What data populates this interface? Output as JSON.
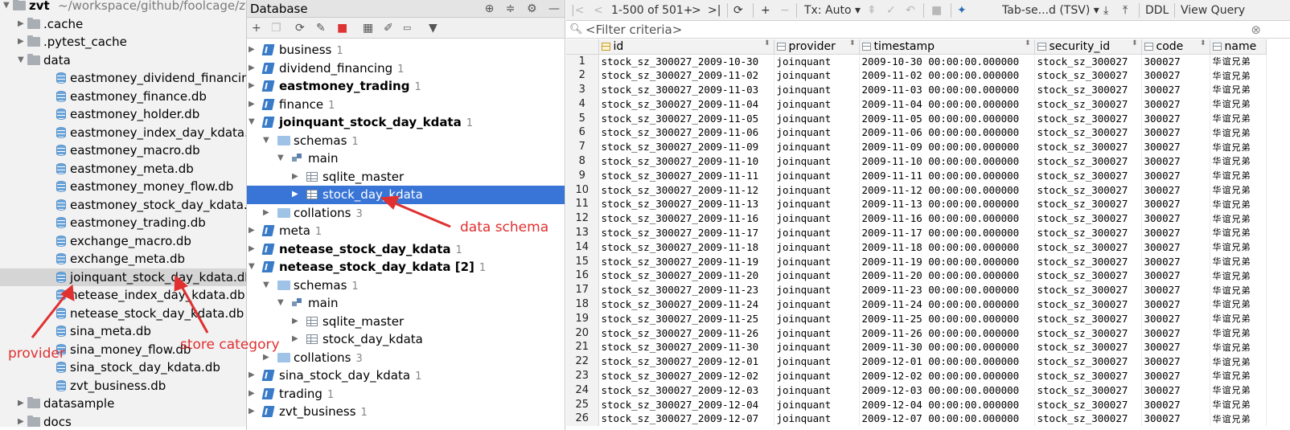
{
  "project": {
    "root_name": "zvt",
    "root_path": "~/workspace/github/foolcage/zvt",
    "rows": [
      {
        "label": "zvt",
        "type": "root",
        "indent": 0,
        "arrow": "▼"
      },
      {
        "label": ".cache",
        "type": "folder",
        "indent": 1,
        "arrow": "▶"
      },
      {
        "label": ".pytest_cache",
        "type": "folder",
        "indent": 1,
        "arrow": "▶"
      },
      {
        "label": "data",
        "type": "folder",
        "indent": 1,
        "arrow": "▼"
      },
      {
        "label": "eastmoney_dividend_financing.db",
        "type": "db",
        "indent": 2
      },
      {
        "label": "eastmoney_finance.db",
        "type": "db",
        "indent": 2
      },
      {
        "label": "eastmoney_holder.db",
        "type": "db",
        "indent": 2
      },
      {
        "label": "eastmoney_index_day_kdata.db",
        "type": "db",
        "indent": 2
      },
      {
        "label": "eastmoney_macro.db",
        "type": "db",
        "indent": 2
      },
      {
        "label": "eastmoney_meta.db",
        "type": "db",
        "indent": 2
      },
      {
        "label": "eastmoney_money_flow.db",
        "type": "db",
        "indent": 2
      },
      {
        "label": "eastmoney_stock_day_kdata.db",
        "type": "db",
        "indent": 2
      },
      {
        "label": "eastmoney_trading.db",
        "type": "db",
        "indent": 2
      },
      {
        "label": "exchange_macro.db",
        "type": "db",
        "indent": 2
      },
      {
        "label": "exchange_meta.db",
        "type": "db",
        "indent": 2
      },
      {
        "label": "joinquant_stock_day_kdata.db",
        "type": "db",
        "indent": 2,
        "selected": true
      },
      {
        "label": "netease_index_day_kdata.db",
        "type": "db",
        "indent": 2
      },
      {
        "label": "netease_stock_day_kdata.db",
        "type": "db",
        "indent": 2
      },
      {
        "label": "sina_meta.db",
        "type": "db",
        "indent": 2
      },
      {
        "label": "sina_money_flow.db",
        "type": "db",
        "indent": 2
      },
      {
        "label": "sina_stock_day_kdata.db",
        "type": "db",
        "indent": 2
      },
      {
        "label": "zvt_business.db",
        "type": "db",
        "indent": 2
      },
      {
        "label": "datasample",
        "type": "folder",
        "indent": 1,
        "arrow": "▶"
      },
      {
        "label": "docs",
        "type": "folder",
        "indent": 1,
        "arrow": "▶"
      }
    ]
  },
  "database": {
    "title": "Database",
    "header_icons": [
      "target-icon",
      "collapse-icon",
      "gear-icon",
      "minimize-icon"
    ],
    "toolbar_icons": [
      "add-icon",
      "copy-icon",
      "refresh-icon",
      "schema-sync-icon",
      "stop-icon",
      "table-icon",
      "edit-icon",
      "console-icon",
      "filter-icon"
    ],
    "tree": [
      {
        "label": "business",
        "count": "1",
        "type": "db",
        "indent": 0,
        "arrow": "▶",
        "bold": false
      },
      {
        "label": "dividend_financing",
        "count": "1",
        "type": "db",
        "indent": 0,
        "arrow": "▶",
        "bold": false
      },
      {
        "label": "eastmoney_trading",
        "count": "1",
        "type": "db",
        "indent": 0,
        "arrow": "▶",
        "bold": true
      },
      {
        "label": "finance",
        "count": "1",
        "type": "db",
        "indent": 0,
        "arrow": "▶",
        "bold": false
      },
      {
        "label": "joinquant_stock_day_kdata",
        "count": "1",
        "type": "db",
        "indent": 0,
        "arrow": "▼",
        "bold": true
      },
      {
        "label": "schemas",
        "count": "1",
        "type": "folder",
        "indent": 1,
        "arrow": "▼",
        "bold": false
      },
      {
        "label": "main",
        "count": "",
        "type": "schema",
        "indent": 2,
        "arrow": "▼",
        "bold": false
      },
      {
        "label": "sqlite_master",
        "count": "",
        "type": "table",
        "indent": 3,
        "arrow": "▶",
        "bold": false
      },
      {
        "label": "stock_day_kdata",
        "count": "",
        "type": "table",
        "indent": 3,
        "arrow": "▶",
        "bold": false,
        "selected": true
      },
      {
        "label": "collations",
        "count": "3",
        "type": "folder",
        "indent": 1,
        "arrow": "▶",
        "bold": false
      },
      {
        "label": "meta",
        "count": "1",
        "type": "db",
        "indent": 0,
        "arrow": "▶",
        "bold": false
      },
      {
        "label": "netease_stock_day_kdata",
        "count": "1",
        "type": "db",
        "indent": 0,
        "arrow": "▶",
        "bold": true
      },
      {
        "label": "netease_stock_day_kdata [2]",
        "count": "1",
        "type": "db",
        "indent": 0,
        "arrow": "▼",
        "bold": true
      },
      {
        "label": "schemas",
        "count": "1",
        "type": "folder",
        "indent": 1,
        "arrow": "▼",
        "bold": false
      },
      {
        "label": "main",
        "count": "",
        "type": "schema",
        "indent": 2,
        "arrow": "▼",
        "bold": false
      },
      {
        "label": "sqlite_master",
        "count": "",
        "type": "table",
        "indent": 3,
        "arrow": "▶",
        "bold": false
      },
      {
        "label": "stock_day_kdata",
        "count": "",
        "type": "table",
        "indent": 3,
        "arrow": "▶",
        "bold": false
      },
      {
        "label": "collations",
        "count": "3",
        "type": "folder",
        "indent": 1,
        "arrow": "▶",
        "bold": false
      },
      {
        "label": "sina_stock_day_kdata",
        "count": "1",
        "type": "db",
        "indent": 0,
        "arrow": "▶",
        "bold": false
      },
      {
        "label": "trading",
        "count": "1",
        "type": "db",
        "indent": 0,
        "arrow": "▶",
        "bold": false
      },
      {
        "label": "zvt_business",
        "count": "1",
        "type": "db",
        "indent": 0,
        "arrow": "▶",
        "bold": false
      }
    ]
  },
  "grid": {
    "toolbar": {
      "first": "|<",
      "prev": "<",
      "page_info": "1-500 of 501+",
      "next": ">",
      "last": ">|",
      "tx_mode": "Tx: Auto",
      "format": "Tab-se...d (TSV)",
      "ddl": "DDL",
      "view_query": "View Query"
    },
    "filter_placeholder": "<Filter criteria>",
    "columns": [
      "id",
      "provider",
      "timestamp",
      "security_id",
      "code",
      "name"
    ],
    "rows": [
      [
        "1",
        "stock_sz_300027_2009-10-30",
        "joinquant",
        "2009-10-30 00:00:00.000000",
        "stock_sz_300027",
        "300027",
        "华谊兄弟"
      ],
      [
        "2",
        "stock_sz_300027_2009-11-02",
        "joinquant",
        "2009-11-02 00:00:00.000000",
        "stock_sz_300027",
        "300027",
        "华谊兄弟"
      ],
      [
        "3",
        "stock_sz_300027_2009-11-03",
        "joinquant",
        "2009-11-03 00:00:00.000000",
        "stock_sz_300027",
        "300027",
        "华谊兄弟"
      ],
      [
        "4",
        "stock_sz_300027_2009-11-04",
        "joinquant",
        "2009-11-04 00:00:00.000000",
        "stock_sz_300027",
        "300027",
        "华谊兄弟"
      ],
      [
        "5",
        "stock_sz_300027_2009-11-05",
        "joinquant",
        "2009-11-05 00:00:00.000000",
        "stock_sz_300027",
        "300027",
        "华谊兄弟"
      ],
      [
        "6",
        "stock_sz_300027_2009-11-06",
        "joinquant",
        "2009-11-06 00:00:00.000000",
        "stock_sz_300027",
        "300027",
        "华谊兄弟"
      ],
      [
        "7",
        "stock_sz_300027_2009-11-09",
        "joinquant",
        "2009-11-09 00:00:00.000000",
        "stock_sz_300027",
        "300027",
        "华谊兄弟"
      ],
      [
        "8",
        "stock_sz_300027_2009-11-10",
        "joinquant",
        "2009-11-10 00:00:00.000000",
        "stock_sz_300027",
        "300027",
        "华谊兄弟"
      ],
      [
        "9",
        "stock_sz_300027_2009-11-11",
        "joinquant",
        "2009-11-11 00:00:00.000000",
        "stock_sz_300027",
        "300027",
        "华谊兄弟"
      ],
      [
        "10",
        "stock_sz_300027_2009-11-12",
        "joinquant",
        "2009-11-12 00:00:00.000000",
        "stock_sz_300027",
        "300027",
        "华谊兄弟"
      ],
      [
        "11",
        "stock_sz_300027_2009-11-13",
        "joinquant",
        "2009-11-13 00:00:00.000000",
        "stock_sz_300027",
        "300027",
        "华谊兄弟"
      ],
      [
        "12",
        "stock_sz_300027_2009-11-16",
        "joinquant",
        "2009-11-16 00:00:00.000000",
        "stock_sz_300027",
        "300027",
        "华谊兄弟"
      ],
      [
        "13",
        "stock_sz_300027_2009-11-17",
        "joinquant",
        "2009-11-17 00:00:00.000000",
        "stock_sz_300027",
        "300027",
        "华谊兄弟"
      ],
      [
        "14",
        "stock_sz_300027_2009-11-18",
        "joinquant",
        "2009-11-18 00:00:00.000000",
        "stock_sz_300027",
        "300027",
        "华谊兄弟"
      ],
      [
        "15",
        "stock_sz_300027_2009-11-19",
        "joinquant",
        "2009-11-19 00:00:00.000000",
        "stock_sz_300027",
        "300027",
        "华谊兄弟"
      ],
      [
        "16",
        "stock_sz_300027_2009-11-20",
        "joinquant",
        "2009-11-20 00:00:00.000000",
        "stock_sz_300027",
        "300027",
        "华谊兄弟"
      ],
      [
        "17",
        "stock_sz_300027_2009-11-23",
        "joinquant",
        "2009-11-23 00:00:00.000000",
        "stock_sz_300027",
        "300027",
        "华谊兄弟"
      ],
      [
        "18",
        "stock_sz_300027_2009-11-24",
        "joinquant",
        "2009-11-24 00:00:00.000000",
        "stock_sz_300027",
        "300027",
        "华谊兄弟"
      ],
      [
        "19",
        "stock_sz_300027_2009-11-25",
        "joinquant",
        "2009-11-25 00:00:00.000000",
        "stock_sz_300027",
        "300027",
        "华谊兄弟"
      ],
      [
        "20",
        "stock_sz_300027_2009-11-26",
        "joinquant",
        "2009-11-26 00:00:00.000000",
        "stock_sz_300027",
        "300027",
        "华谊兄弟"
      ],
      [
        "21",
        "stock_sz_300027_2009-11-30",
        "joinquant",
        "2009-11-30 00:00:00.000000",
        "stock_sz_300027",
        "300027",
        "华谊兄弟"
      ],
      [
        "22",
        "stock_sz_300027_2009-12-01",
        "joinquant",
        "2009-12-01 00:00:00.000000",
        "stock_sz_300027",
        "300027",
        "华谊兄弟"
      ],
      [
        "23",
        "stock_sz_300027_2009-12-02",
        "joinquant",
        "2009-12-02 00:00:00.000000",
        "stock_sz_300027",
        "300027",
        "华谊兄弟"
      ],
      [
        "24",
        "stock_sz_300027_2009-12-03",
        "joinquant",
        "2009-12-03 00:00:00.000000",
        "stock_sz_300027",
        "300027",
        "华谊兄弟"
      ],
      [
        "25",
        "stock_sz_300027_2009-12-04",
        "joinquant",
        "2009-12-04 00:00:00.000000",
        "stock_sz_300027",
        "300027",
        "华谊兄弟"
      ],
      [
        "26",
        "stock_sz_300027_2009-12-07",
        "joinquant",
        "2009-12-07 00:00:00.000000",
        "stock_sz_300027",
        "300027",
        "华谊兄弟"
      ]
    ]
  },
  "annotations": {
    "data_schema": "data schema",
    "provider": "provider",
    "store_category": "store category"
  },
  "colors": {
    "selection_blue": "#3875d6",
    "annotation_red": "#e03030",
    "panel_gray": "#f2f2f2"
  }
}
